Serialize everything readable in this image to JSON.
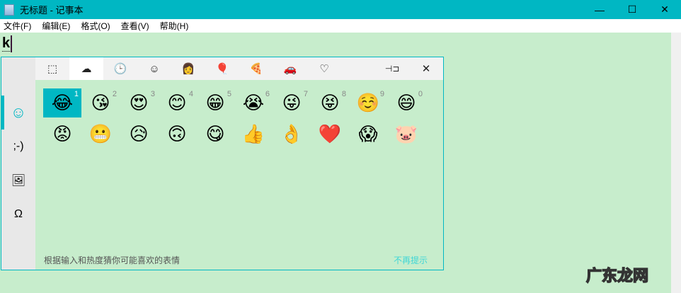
{
  "window": {
    "title": "无标题 - 记事本",
    "minimize": "—",
    "maximize": "☐",
    "close": "✕"
  },
  "menu": [
    "文件(F)",
    "编辑(E)",
    "格式(O)",
    "查看(V)",
    "帮助(H)"
  ],
  "editor": {
    "text": "k"
  },
  "emoji_panel": {
    "sidebar": [
      {
        "name": "emoji",
        "glyph": "☺"
      },
      {
        "name": "kaomoji",
        "glyph": ";-)"
      },
      {
        "name": "gif",
        "glyph": "🖼"
      },
      {
        "name": "symbols",
        "glyph": "Ω"
      }
    ],
    "tabs": [
      {
        "name": "recent-frame",
        "glyph": "⬚"
      },
      {
        "name": "suggested",
        "glyph": "☁"
      },
      {
        "name": "recent",
        "glyph": "🕒"
      },
      {
        "name": "smileys",
        "glyph": "☺"
      },
      {
        "name": "people",
        "glyph": "👩"
      },
      {
        "name": "celebration",
        "glyph": "🎈"
      },
      {
        "name": "food",
        "glyph": "🍕"
      },
      {
        "name": "travel",
        "glyph": "🚗"
      },
      {
        "name": "hearts",
        "glyph": "♡"
      }
    ],
    "pin": "⊣⊐",
    "close": "✕",
    "row1": [
      {
        "e": "😂",
        "n": "1"
      },
      {
        "e": "😘",
        "n": "2"
      },
      {
        "e": "😍",
        "n": "3"
      },
      {
        "e": "😊",
        "n": "4"
      },
      {
        "e": "😁",
        "n": "5"
      },
      {
        "e": "😭",
        "n": "6"
      },
      {
        "e": "😜",
        "n": "7"
      },
      {
        "e": "😝",
        "n": "8"
      },
      {
        "e": "☺️",
        "n": "9"
      },
      {
        "e": "😄",
        "n": "0"
      }
    ],
    "row2": [
      "😡",
      "😬",
      "😥",
      "🙃",
      "😋",
      "👍",
      "👌",
      "❤️",
      "😱",
      "🐷"
    ],
    "hint": "根据输入和热度猜你可能喜欢的表情",
    "dismiss": "不再提示"
  },
  "watermark": "广东龙网",
  "colors": {
    "accent": "#00b7c3",
    "editor_bg": "#c7edcc"
  }
}
